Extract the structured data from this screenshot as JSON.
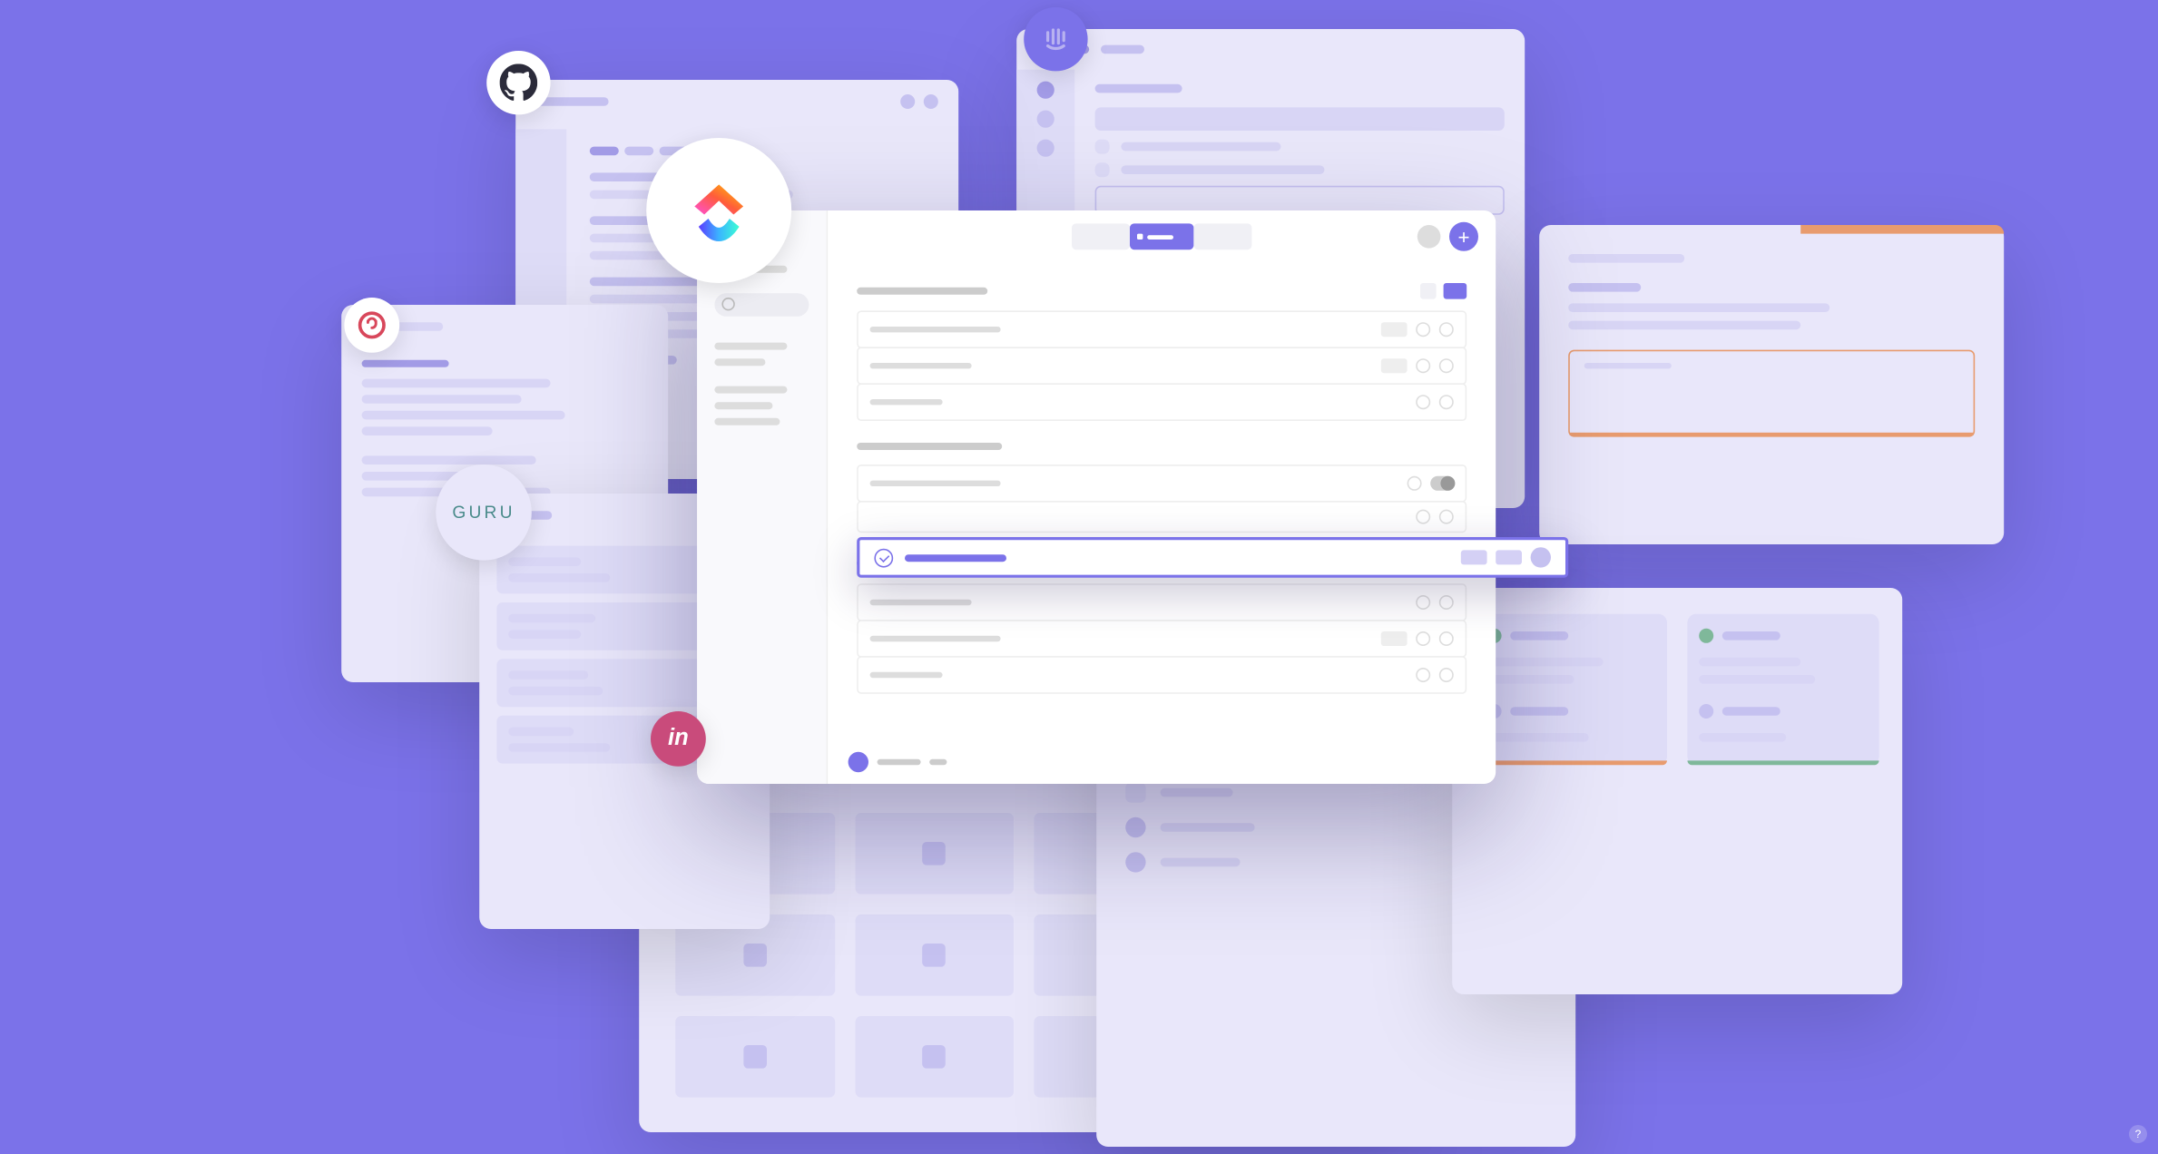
{
  "scene": {
    "background_color": "#7B72E9",
    "help_icon": "?"
  },
  "badges": {
    "github": "github-icon",
    "intercom": "intercom-icon",
    "meta": "meta-icon",
    "guru_label": "GURU",
    "invision": "in",
    "clickup": "clickup-icon"
  },
  "main_app": {
    "plus": "+",
    "tabs": [
      "view-1",
      "view-2",
      "view-3"
    ]
  }
}
